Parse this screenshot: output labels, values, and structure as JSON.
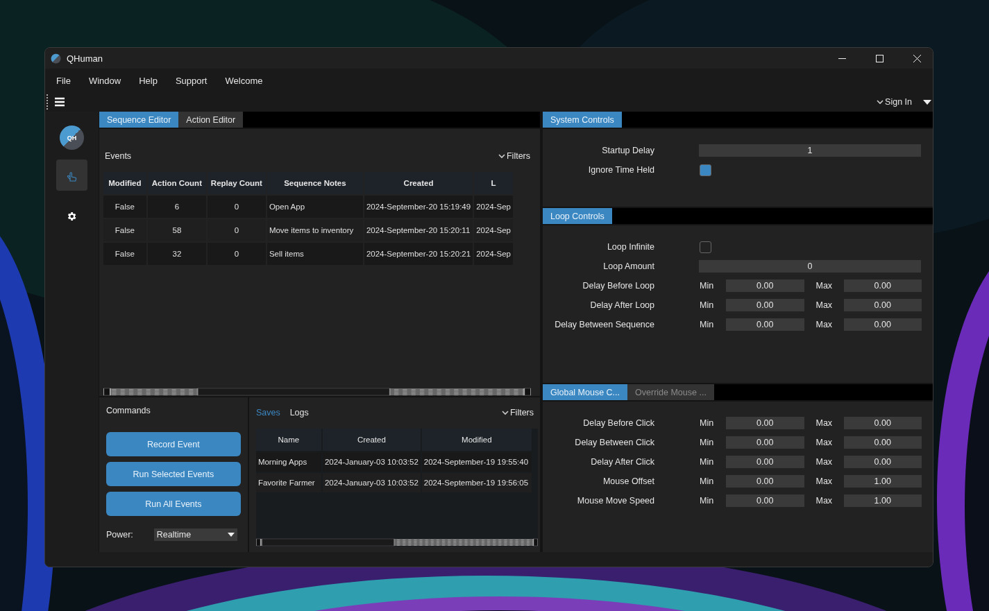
{
  "window": {
    "title": "QHuman"
  },
  "menu": [
    "File",
    "Window",
    "Help",
    "Support",
    "Welcome"
  ],
  "account": {
    "label": "Sign In"
  },
  "sidebar": {
    "avatar": "QH",
    "items": [
      {
        "kind": "pointer",
        "selected": true
      },
      {
        "kind": "settings",
        "selected": false
      }
    ]
  },
  "editor_tabs": [
    {
      "label": "Sequence Editor",
      "selected": true
    },
    {
      "label": "Action Editor",
      "selected": false
    }
  ],
  "events": {
    "title": "Events",
    "filters": "Filters",
    "columns": [
      "Modified",
      "Action Count",
      "Replay Count",
      "Sequence Notes",
      "Created",
      "L"
    ],
    "rows": [
      [
        "False",
        "6",
        "0",
        "Open App",
        "2024-September-20 15:19:49",
        "2024-Sep"
      ],
      [
        "False",
        "58",
        "0",
        "Move items to inventory",
        "2024-September-20 15:20:11",
        "2024-Sep"
      ],
      [
        "False",
        "32",
        "0",
        "Sell items",
        "2024-September-20 15:20:21",
        "2024-Sep"
      ]
    ]
  },
  "commands": {
    "title": "Commands",
    "buttons": [
      "Record Event",
      "Run Selected Events",
      "Run All Events"
    ],
    "power": {
      "label": "Power:",
      "value": "Realtime"
    }
  },
  "saves": {
    "tabs": [
      {
        "label": "Saves",
        "selected": true
      },
      {
        "label": "Logs",
        "selected": false
      }
    ],
    "filters": "Filters",
    "columns": [
      "Name",
      "Created",
      "Modified"
    ],
    "rows": [
      [
        "Morning Apps",
        "2024-January-03 10:03:52",
        "2024-September-19 19:55:40"
      ],
      [
        "Favorite Farmer",
        "2024-January-03 10:03:52",
        "2024-September-19 19:56:05"
      ]
    ]
  },
  "system_controls": {
    "tabs": [
      {
        "label": "System Controls",
        "selected": true
      }
    ],
    "rows": [
      {
        "kind": "number",
        "label": "Startup Delay",
        "value": "1"
      },
      {
        "kind": "checkbox",
        "label": "Ignore Time Held",
        "checked": true
      }
    ]
  },
  "loop_controls": {
    "tabs": [
      {
        "label": "Loop Controls",
        "selected": true
      }
    ],
    "rows": [
      {
        "kind": "checkbox",
        "label": "Loop Infinite",
        "checked": false
      },
      {
        "kind": "number",
        "label": "Loop Amount",
        "value": "0"
      },
      {
        "kind": "range",
        "label": "Delay Before Loop",
        "min_label": "Min",
        "min": "0.00",
        "max_label": "Max",
        "max": "0.00"
      },
      {
        "kind": "range",
        "label": "Delay After Loop",
        "min_label": "Min",
        "min": "0.00",
        "max_label": "Max",
        "max": "0.00"
      },
      {
        "kind": "range",
        "label": "Delay Between Sequence",
        "min_label": "Min",
        "min": "0.00",
        "max_label": "Max",
        "max": "0.00"
      }
    ]
  },
  "mouse_controls": {
    "tabs": [
      {
        "label": "Global Mouse C...",
        "selected": true
      },
      {
        "label": "Override Mouse ...",
        "selected": false
      }
    ],
    "rows": [
      {
        "kind": "range",
        "label": "Delay Before Click",
        "min_label": "Min",
        "min": "0.00",
        "max_label": "Max",
        "max": "0.00"
      },
      {
        "kind": "range",
        "label": "Delay Between Click",
        "min_label": "Min",
        "min": "0.00",
        "max_label": "Max",
        "max": "0.00"
      },
      {
        "kind": "range",
        "label": "Delay After Click",
        "min_label": "Min",
        "min": "0.00",
        "max_label": "Max",
        "max": "0.00"
      },
      {
        "kind": "range",
        "label": "Mouse Offset",
        "min_label": "Min",
        "min": "0.00",
        "max_label": "Max",
        "max": "1.00"
      },
      {
        "kind": "range",
        "label": "Mouse Move Speed",
        "min_label": "Min",
        "min": "0.00",
        "max_label": "Max",
        "max": "1.00"
      }
    ]
  }
}
